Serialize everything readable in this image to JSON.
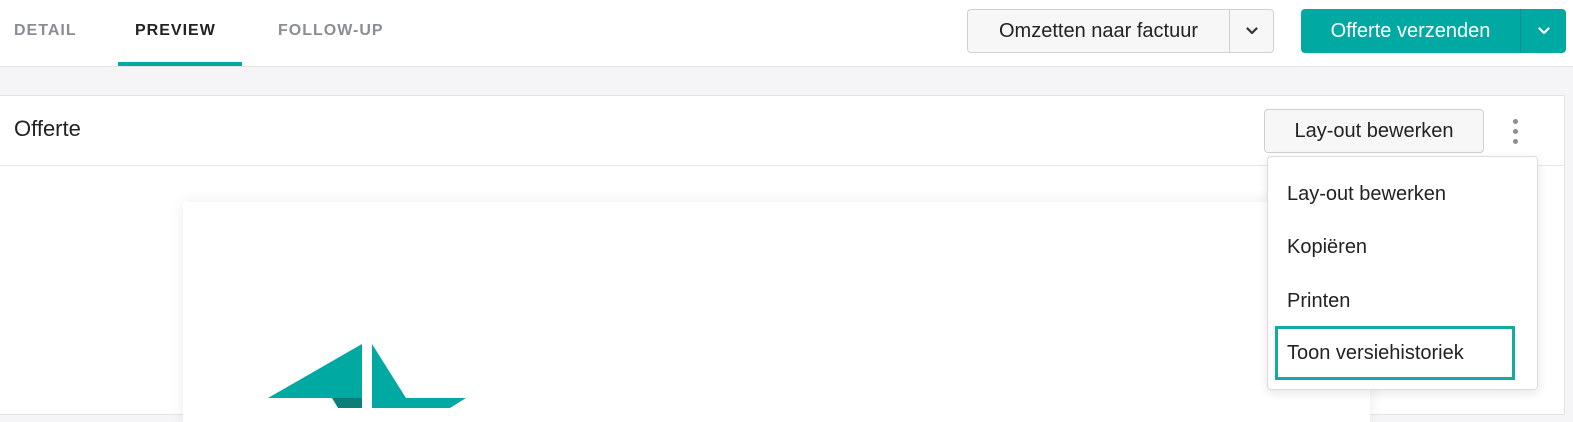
{
  "tabs": [
    {
      "label": "DETAIL",
      "active": false
    },
    {
      "label": "PREVIEW",
      "active": true
    },
    {
      "label": "FOLLOW-UP",
      "active": false
    }
  ],
  "header_actions": {
    "convert_label": "Omzetten naar factuur",
    "send_label": "Offerte verzenden"
  },
  "panel": {
    "title": "Offerte",
    "layout_button_label": "Lay-out bewerken"
  },
  "menu": {
    "items": [
      {
        "label": "Lay-out bewerken"
      },
      {
        "label": "Kopiëren"
      },
      {
        "label": "Printen"
      },
      {
        "label": "Toon versiehistoriek",
        "highlighted": true
      }
    ]
  },
  "colors": {
    "accent": "#00a9a1",
    "text": "#222222",
    "muted": "#8a8d93"
  },
  "icons": {
    "dropdown": "chevron-down-icon",
    "more": "kebab-menu-icon",
    "logo": "company-logo"
  }
}
